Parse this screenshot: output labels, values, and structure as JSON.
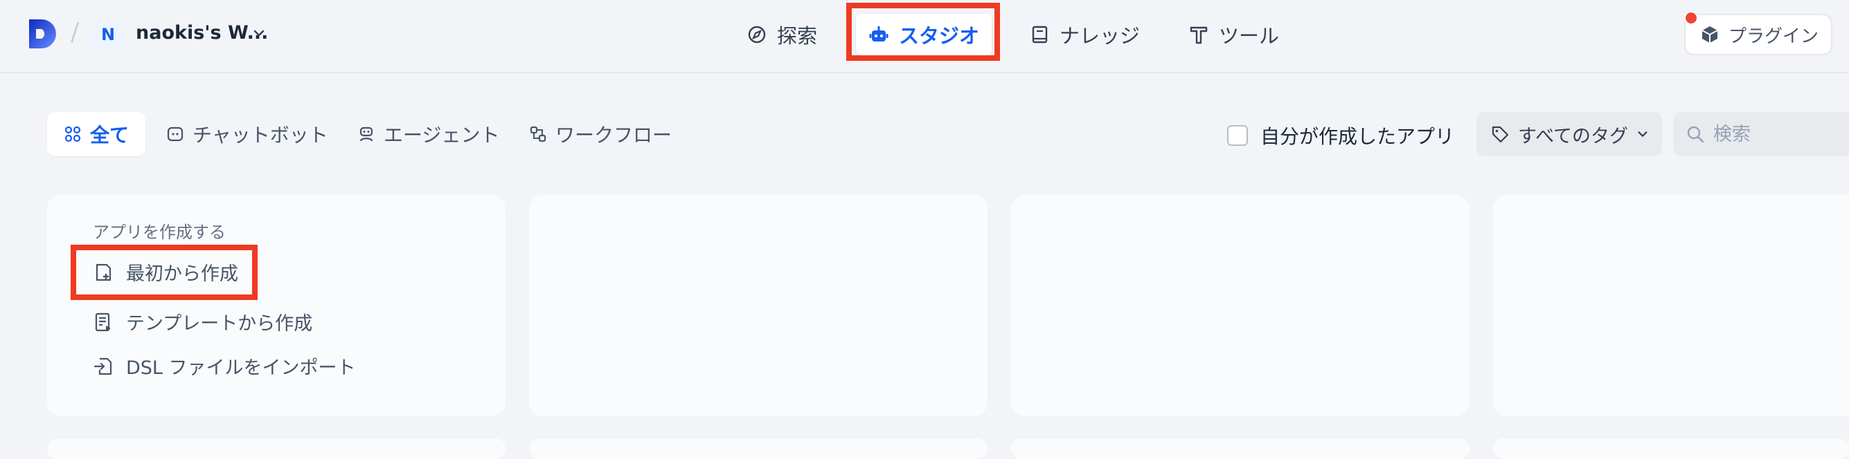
{
  "workspace": {
    "avatar_letter": "N",
    "name": "naokis's W..."
  },
  "nav": [
    {
      "label": "探索",
      "icon": "compass-icon"
    },
    {
      "label": "スタジオ",
      "icon": "robot-icon",
      "active": true
    },
    {
      "label": "ナレッジ",
      "icon": "book-icon"
    },
    {
      "label": "ツール",
      "icon": "tool-icon"
    }
  ],
  "plugin": {
    "label": "プラグイン"
  },
  "filters": [
    {
      "label": "全て",
      "icon": "grid-icon",
      "active": true
    },
    {
      "label": "チャットボット",
      "icon": "chat-bot-icon"
    },
    {
      "label": "エージェント",
      "icon": "agent-icon"
    },
    {
      "label": "ワークフロー",
      "icon": "workflow-icon"
    }
  ],
  "mine_label": "自分が作成したアプリ",
  "tags_label": "すべてのタグ",
  "search": {
    "placeholder": "検索"
  },
  "create_card": {
    "title": "アプリを作成する",
    "items": [
      {
        "label": "最初から作成",
        "icon": "new-file-icon"
      },
      {
        "label": "テンプレートから作成",
        "icon": "template-icon"
      },
      {
        "label": "DSL ファイルをインポート",
        "icon": "import-icon"
      }
    ]
  },
  "colors": {
    "accent": "#155eef",
    "highlight": "#ee3a22",
    "background": "#f2f4f7"
  }
}
